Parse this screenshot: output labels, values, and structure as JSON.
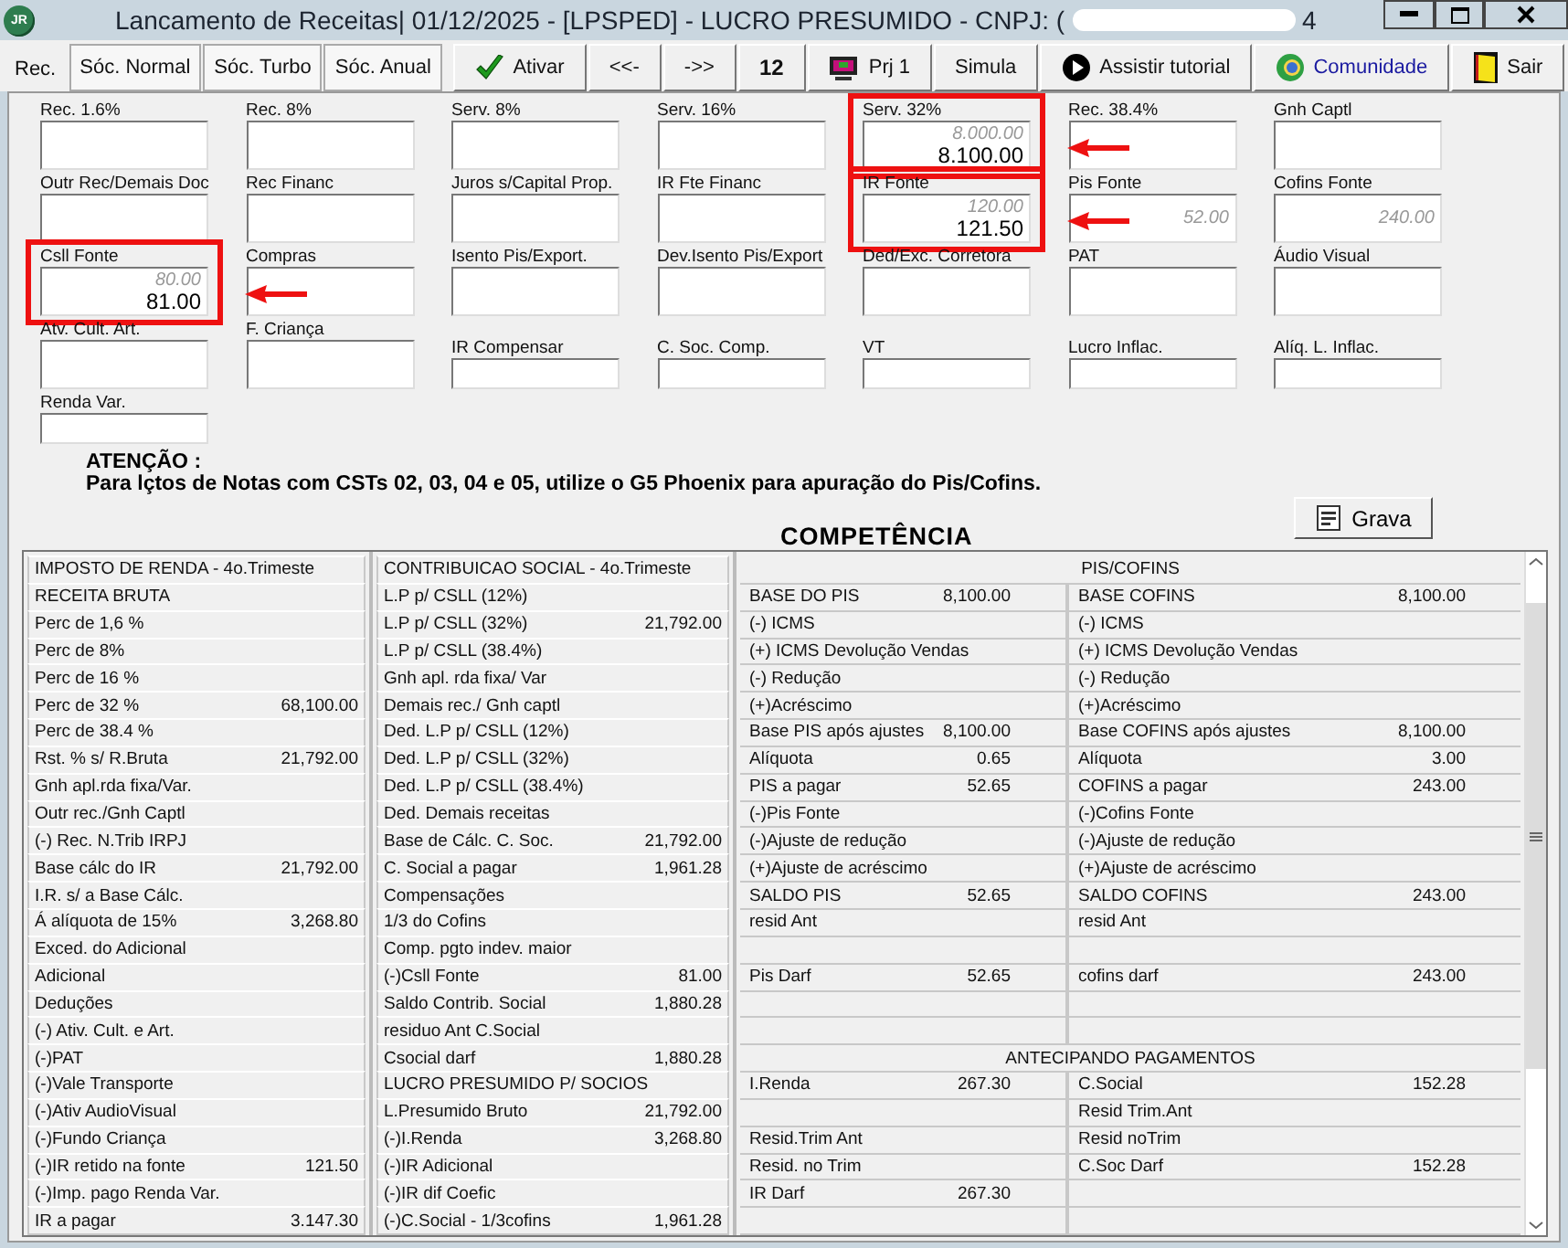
{
  "window": {
    "logo": "JR",
    "title": "Lancamento de Receitas|  01/12/2025 - [LPSPED] - LUCRO PRESUMIDO - CNPJ: (",
    "title_tail": "4"
  },
  "toolbar": {
    "tabs": [
      {
        "label": "Rec.",
        "selected": true
      },
      {
        "label": "Sóc. Normal",
        "selected": false
      },
      {
        "label": "Sóc. Turbo",
        "selected": false
      },
      {
        "label": "Sóc. Anual",
        "selected": false
      }
    ],
    "buttons": [
      {
        "label": "Ativar",
        "kind": "check"
      },
      {
        "label": "<<-",
        "kind": "plain"
      },
      {
        "label": "->>",
        "kind": "plain"
      },
      {
        "label": "12",
        "kind": "bold"
      },
      {
        "label": "Prj 1",
        "kind": "monitor"
      },
      {
        "label": "Simula",
        "kind": "plain"
      },
      {
        "label": "Assistir tutorial",
        "kind": "play"
      },
      {
        "label": "Comunidade",
        "kind": "link"
      },
      {
        "label": "Sair",
        "kind": "door"
      }
    ]
  },
  "form": {
    "rows": [
      [
        {
          "label": "Rec. 1.6%",
          "kind": "tall"
        },
        {
          "label": "Rec. 8%",
          "kind": "tall"
        },
        {
          "label": "Serv. 8%",
          "kind": "tall"
        },
        {
          "label": "Serv. 16%",
          "kind": "tall"
        },
        {
          "label": "Serv. 32%",
          "kind": "tall",
          "previous": "8.000.00",
          "value": "8.100.00",
          "highlighted": true
        },
        {
          "label": "Rec. 38.4%",
          "kind": "tall"
        },
        {
          "label": "Gnh Captl",
          "kind": "tall"
        }
      ],
      [
        {
          "label": "Outr Rec/Demais Doc",
          "kind": "tall"
        },
        {
          "label": "Rec Financ",
          "kind": "tall"
        },
        {
          "label": "Juros s/Capital Prop.",
          "kind": "tall"
        },
        {
          "label": "IR Fte Financ",
          "kind": "tall"
        },
        {
          "label": "IR Fonte",
          "kind": "tall",
          "previous": "120.00",
          "value": "121.50",
          "highlighted": true
        },
        {
          "label": "Pis Fonte",
          "kind": "tall",
          "previous": "52.00"
        },
        {
          "label": "Cofins Fonte",
          "kind": "tall",
          "previous": "240.00"
        }
      ],
      [
        {
          "label": "Csll Fonte",
          "kind": "tall",
          "previous": "80.00",
          "value": "81.00",
          "highlighted": true
        },
        {
          "label": "Compras",
          "kind": "tall"
        },
        {
          "label": "Isento Pis/Export.",
          "kind": "tall"
        },
        {
          "label": "Dev.Isento Pis/Export",
          "kind": "tall"
        },
        {
          "label": "Ded/Exc. Corretora",
          "kind": "tall"
        },
        {
          "label": "PAT",
          "kind": "tall"
        },
        {
          "label": "Áudio Visual",
          "kind": "tall"
        }
      ],
      [
        {
          "label": "Atv. Cult. Art.",
          "kind": "tall"
        },
        {
          "label": "F. Criança",
          "kind": "tall"
        },
        {
          "label": "IR Compensar",
          "kind": "short"
        },
        {
          "label": "C. Soc. Comp.",
          "kind": "short"
        },
        {
          "label": "VT",
          "kind": "short"
        },
        {
          "label": "Lucro Inflac.",
          "kind": "short"
        },
        {
          "label": "Alíq. L. Inflac.",
          "kind": "short"
        }
      ],
      [
        {
          "label": "Renda Var.",
          "kind": "short"
        }
      ]
    ]
  },
  "notice": {
    "title": "ATENÇÃO :",
    "text": "Para lçtos de Notas com CSTs 02, 03, 04 e 05, utilize o G5 Phoenix para apuração do Pis/Cofins."
  },
  "competencia": {
    "title": "COMPETÊNCIA",
    "save_button": "Grava"
  },
  "imposto_renda": {
    "header": "IMPOSTO DE RENDA - 4o.Trimeste",
    "rows": [
      {
        "label": "RECEITA BRUTA"
      },
      {
        "label": "Perc de 1,6 %"
      },
      {
        "label": "Perc de 8%"
      },
      {
        "label": "Perc de 16 %"
      },
      {
        "label": "Perc de 32 %",
        "value": "68,100.00"
      },
      {
        "label": "Perc de 38.4 %"
      },
      {
        "label": "Rst.  % s/ R.Bruta",
        "value": "21,792.00"
      },
      {
        "label": "Gnh apl.rda fixa/Var."
      },
      {
        "label": "Outr rec./Gnh Captl"
      },
      {
        "label": "(-) Rec. N.Trib IRPJ"
      },
      {
        "label": "Base cálc do IR",
        "value": "21,792.00"
      },
      {
        "label": "I.R. s/ a Base  Cálc."
      },
      {
        "label": "Á alíquota de 15%",
        "value": "3,268.80"
      },
      {
        "label": "Exced. do Adicional"
      },
      {
        "label": "Adicional"
      },
      {
        "label": "Deduções"
      },
      {
        "label": "(-) Ativ. Cult. e Art."
      },
      {
        "label": "(-)PAT"
      },
      {
        "label": "(-)Vale Transporte"
      },
      {
        "label": "(-)Ativ AudioVisual"
      },
      {
        "label": "(-)Fundo Criança"
      },
      {
        "label": "(-)IR retido na fonte",
        "value": "121.50"
      },
      {
        "label": "(-)Imp. pago Renda Var."
      },
      {
        "label": "IR a pagar",
        "value": "3.147.30"
      }
    ]
  },
  "contribuicao_social": {
    "header": "CONTRIBUICAO SOCIAL - 4o.Trimeste",
    "rows": [
      {
        "label": "L.P p/ CSLL (12%)"
      },
      {
        "label": "L.P p/ CSLL (32%)",
        "value": "21,792.00"
      },
      {
        "label": "L.P p/ CSLL (38.4%)"
      },
      {
        "label": "Gnh apl. rda fixa/ Var"
      },
      {
        "label": "Demais rec./ Gnh captl"
      },
      {
        "label": "Ded. L.P p/ CSLL (12%)"
      },
      {
        "label": "Ded. L.P p/ CSLL (32%)"
      },
      {
        "label": "Ded. L.P p/ CSLL (38.4%)"
      },
      {
        "label": "Ded. Demais receitas"
      },
      {
        "label": "Base de Cálc. C. Soc.",
        "value": "21,792.00"
      },
      {
        "label": "C. Social a pagar",
        "value": "1,961.28"
      },
      {
        "label": "Compensações"
      },
      {
        "label": "1/3 do Cofins"
      },
      {
        "label": "Comp. pgto indev. maior"
      },
      {
        "label": "(-)Csll Fonte",
        "value": "81.00"
      },
      {
        "label": "Saldo Contrib. Social",
        "value": "1,880.28"
      },
      {
        "label": "residuo Ant C.Social"
      },
      {
        "label": "Csocial darf",
        "value": "1,880.28"
      },
      {
        "label": "LUCRO  PRESUMIDO   P/  SOCIOS"
      },
      {
        "label": "L.Presumido Bruto",
        "value": "21,792.00"
      },
      {
        "label": "(-)I.Renda",
        "value": "3,268.80"
      },
      {
        "label": "(-)IR Adicional"
      },
      {
        "label": "(-)IR dif Coefic"
      },
      {
        "label": "(-)C.Social - 1/3cofins",
        "value": "1,961.28"
      }
    ]
  },
  "pis_cofins": {
    "rows": [
      {
        "kind": "header",
        "text": "PIS/COFINS"
      },
      {
        "kind": "pair",
        "left": {
          "label": "BASE DO PIS",
          "value": "8,100.00"
        },
        "right": {
          "label": "BASE COFINS",
          "value": "8,100.00"
        }
      },
      {
        "kind": "pair",
        "left": {
          "label": "(-) ICMS"
        },
        "right": {
          "label": "(-) ICMS"
        }
      },
      {
        "kind": "pair",
        "left": {
          "label": "(+) ICMS Devolução Vendas"
        },
        "right": {
          "label": "(+) ICMS Devolução Vendas"
        }
      },
      {
        "kind": "pair",
        "left": {
          "label": "(-) Redução"
        },
        "right": {
          "label": "(-) Redução"
        }
      },
      {
        "kind": "pair",
        "left": {
          "label": "(+)Acréscimo"
        },
        "right": {
          "label": "(+)Acréscimo"
        }
      },
      {
        "kind": "pair",
        "left": {
          "label": "Base PIS após ajustes",
          "value": "8,100.00"
        },
        "right": {
          "label": "Base COFINS após ajustes",
          "value": "8,100.00"
        }
      },
      {
        "kind": "pair",
        "left": {
          "label": "Alíquota",
          "value": "0.65"
        },
        "right": {
          "label": "Alíquota",
          "value": "3.00"
        }
      },
      {
        "kind": "pair",
        "left": {
          "label": "PIS a pagar",
          "value": "52.65"
        },
        "right": {
          "label": "COFINS a pagar",
          "value": "243.00"
        }
      },
      {
        "kind": "pair",
        "left": {
          "label": "(-)Pis Fonte"
        },
        "right": {
          "label": "(-)Cofins Fonte"
        }
      },
      {
        "kind": "pair",
        "left": {
          "label": "(-)Ajuste de redução"
        },
        "right": {
          "label": "(-)Ajuste de redução"
        }
      },
      {
        "kind": "pair",
        "left": {
          "label": "(+)Ajuste de acréscimo"
        },
        "right": {
          "label": "(+)Ajuste de acréscimo"
        }
      },
      {
        "kind": "pair",
        "left": {
          "label": "SALDO PIS",
          "value": "52.65"
        },
        "right": {
          "label": "SALDO COFINS",
          "value": "243.00"
        }
      },
      {
        "kind": "pair",
        "left": {
          "label": "resid Ant"
        },
        "right": {
          "label": "resid Ant"
        }
      },
      {
        "kind": "pair",
        "left": {},
        "right": {}
      },
      {
        "kind": "pair",
        "left": {
          "label": "Pis Darf",
          "value": "52.65"
        },
        "right": {
          "label": "cofins darf",
          "value": "243.00"
        }
      },
      {
        "kind": "pair",
        "left": {},
        "right": {}
      },
      {
        "kind": "pair",
        "left": {},
        "right": {}
      },
      {
        "kind": "header",
        "text": "ANTECIPANDO PAGAMENTOS"
      },
      {
        "kind": "pair",
        "left": {
          "label": "I.Renda",
          "value": "267.30"
        },
        "right": {
          "label": "C.Social",
          "value": "152.28"
        }
      },
      {
        "kind": "pair",
        "left": {},
        "right": {
          "label": "Resid Trim.Ant"
        }
      },
      {
        "kind": "pair",
        "left": {
          "label": "Resid.Trim Ant"
        },
        "right": {
          "label": "Resid noTrim"
        }
      },
      {
        "kind": "pair",
        "left": {
          "label": "Resid. no Trim"
        },
        "right": {
          "label": "C.Soc Darf",
          "value": "152.28"
        }
      },
      {
        "kind": "pair",
        "left": {
          "label": "IR Darf",
          "value": "267.30"
        },
        "right": {}
      },
      {
        "kind": "pair",
        "left": {},
        "right": {}
      }
    ]
  }
}
